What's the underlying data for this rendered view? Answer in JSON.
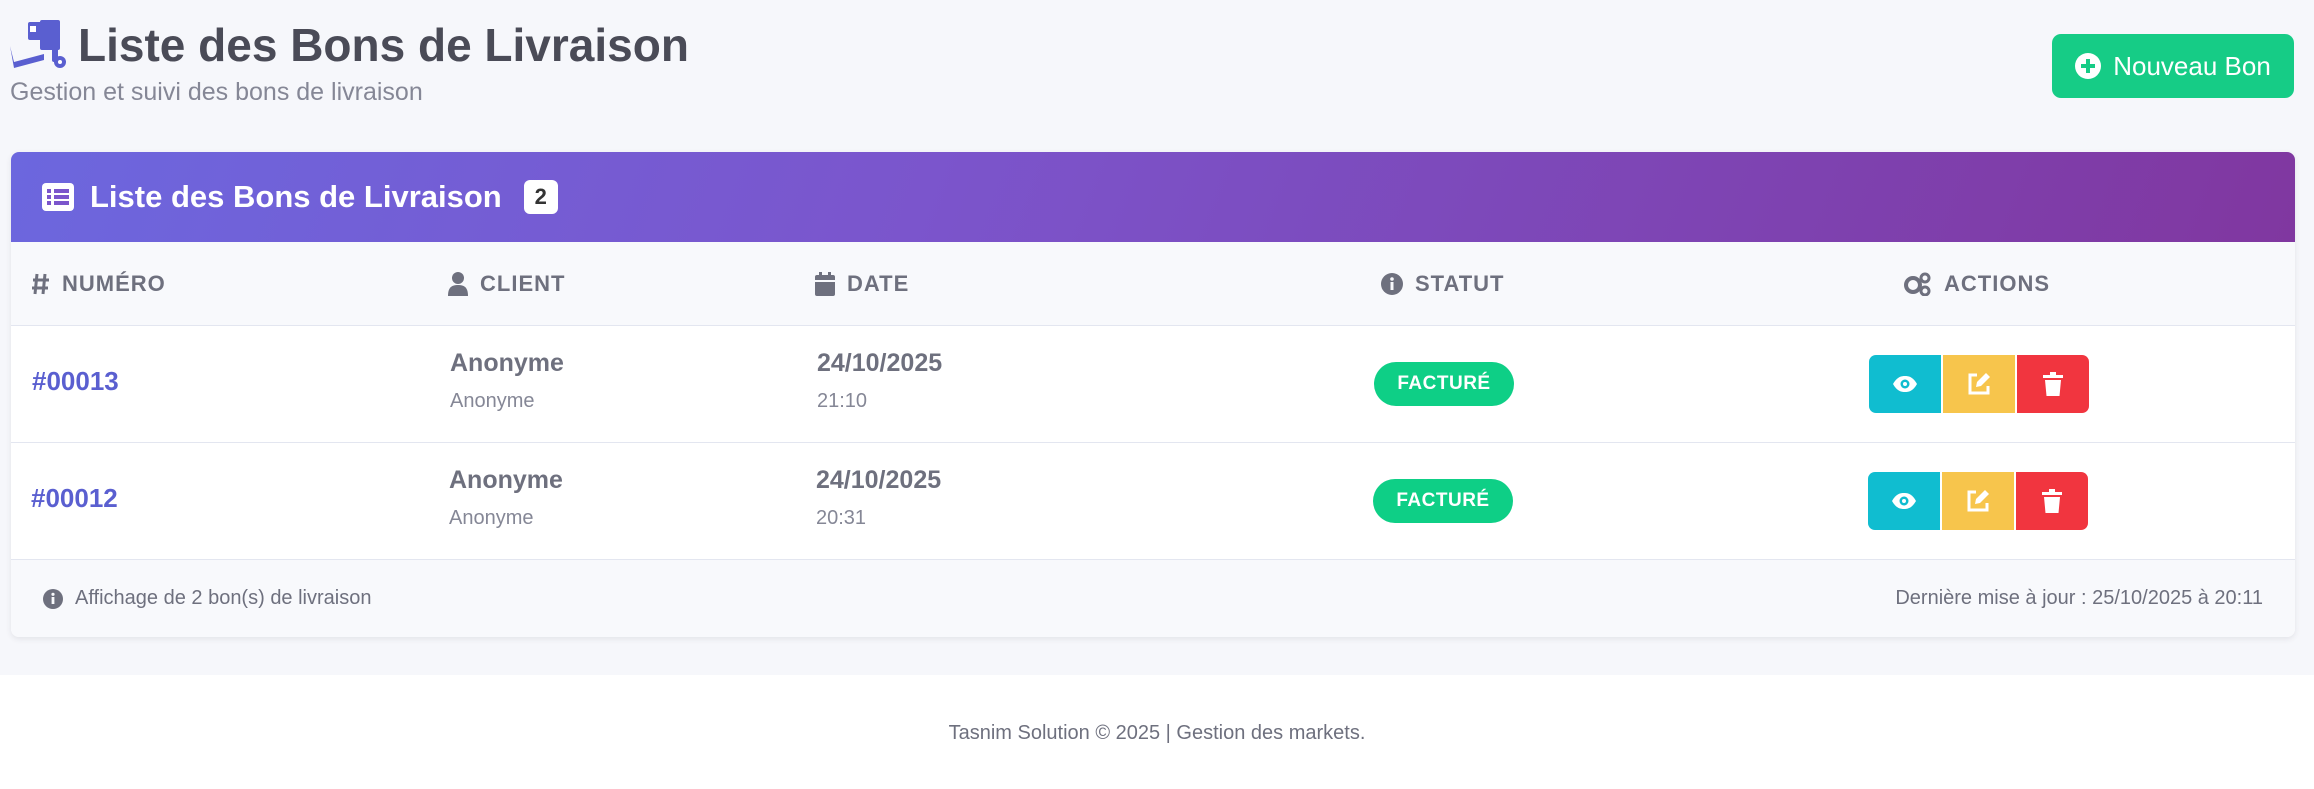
{
  "header": {
    "title": "Liste des Bons de Livraison",
    "subtitle": "Gestion et suivi des bons de livraison",
    "title_icon": "dolly-icon",
    "new_button_label": "Nouveau Bon"
  },
  "card": {
    "title": "Liste des Bons de Livraison",
    "count": "2",
    "columns": {
      "numero": "NUMÉRO",
      "client": "CLIENT",
      "date": "DATE",
      "statut": "STATUT",
      "actions": "ACTIONS"
    },
    "rows": [
      {
        "numero": "#00013",
        "client_name": "Anonyme",
        "client_sub": "Anonyme",
        "date": "24/10/2025",
        "time": "21:10",
        "status": "FACTURÉ"
      },
      {
        "numero": "#00012",
        "client_name": "Anonyme",
        "client_sub": "Anonyme",
        "date": "24/10/2025",
        "time": "20:31",
        "status": "FACTURÉ"
      }
    ],
    "footer_left": "Affichage de 2 bon(s) de livraison",
    "footer_right": "Dernière mise à jour : 25/10/2025 à 20:11"
  },
  "page_footer": "Tasnim Solution © 2025 | Gestion des markets.",
  "colors": {
    "primary": "#5a5fd0",
    "success": "#16cc86",
    "info": "#10bdd0",
    "warning": "#f7c54c",
    "danger": "#f1353f"
  }
}
